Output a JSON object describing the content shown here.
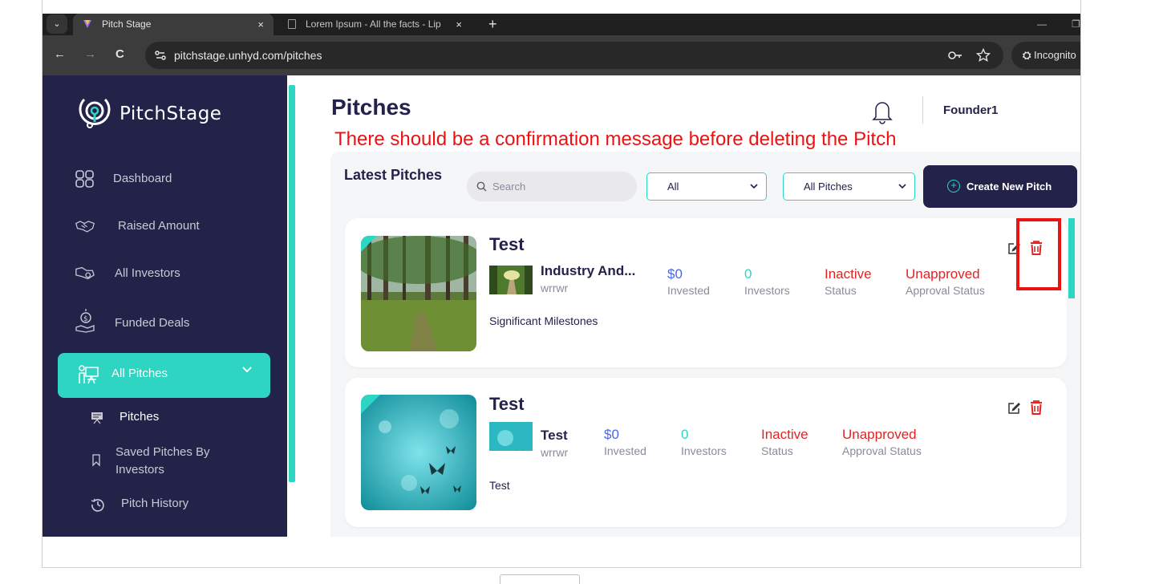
{
  "browser": {
    "tabs": [
      {
        "title": "Pitch Stage",
        "close": "×"
      },
      {
        "title": "Lorem Ipsum - All the facts - Lip",
        "close": "×"
      }
    ],
    "new_tab": "+",
    "minimize": "—",
    "restore": "❐",
    "tab_menu": "⌄",
    "back": "←",
    "forward": "→",
    "reload": "C",
    "url": "pitchstage.unhyd.com/pitches",
    "incognito_label": "Incognito"
  },
  "sidebar": {
    "brand": "PitchStage",
    "items": [
      {
        "label": "Dashboard",
        "icon": "dashboard-icon"
      },
      {
        "label": "Raised Amount",
        "icon": "handshake-icon"
      },
      {
        "label": "All Investors",
        "icon": "investors-icon"
      },
      {
        "label": "Funded Deals",
        "icon": "funded-icon"
      }
    ],
    "active": {
      "label": "All Pitches",
      "icon": "presentation-icon"
    },
    "subitems": [
      {
        "label": "Pitches",
        "icon": "board-icon"
      },
      {
        "label": "Saved Pitches By Investors",
        "icon": "bookmark-icon"
      },
      {
        "label": "Pitch History",
        "icon": "history-icon"
      }
    ],
    "colors": {
      "background": "#23234a",
      "accent": "#2ed5c2"
    }
  },
  "header": {
    "title": "Pitches",
    "user": "Founder1"
  },
  "annotation": "There should be a confirmation message before deleting the Pitch",
  "panel": {
    "heading": "Latest Pitches",
    "search_placeholder": "Search",
    "filter1": "All",
    "filter2": "All Pitches",
    "create_label": "Create New Pitch"
  },
  "pitches": [
    {
      "title": "Test",
      "industry": "Industry And...",
      "sub": "wrrwr",
      "invested": "$0",
      "invested_label": "Invested",
      "investors": "0",
      "investors_label": "Investors",
      "status": "Inactive",
      "status_label": "Status",
      "approval": "Unapproved",
      "approval_label": "Approval Status",
      "description": "Significant Milestones"
    },
    {
      "title": "Test",
      "industry": "Test",
      "sub": "wrrwr",
      "invested": "$0",
      "invested_label": "Invested",
      "investors": "0",
      "investors_label": "Investors",
      "status": "Inactive",
      "status_label": "Status",
      "approval": "Unapproved",
      "approval_label": "Approval Status",
      "description": "Test"
    }
  ]
}
